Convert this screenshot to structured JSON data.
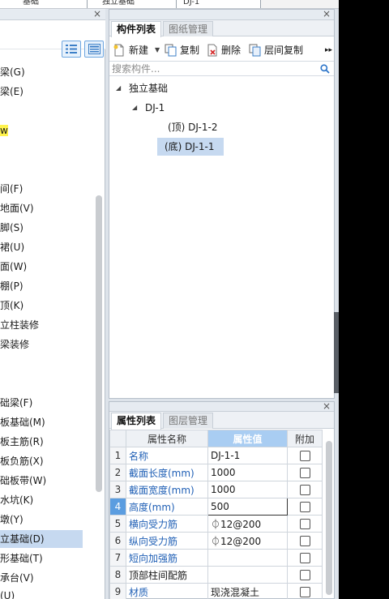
{
  "top_strip": {
    "cells": [
      "基础",
      "独立基础",
      "DJ-1"
    ]
  },
  "left_panel": {
    "items": [
      {
        "label": "梁(G)"
      },
      {
        "label": "梁(E)"
      },
      {
        "label": "w"
      },
      {
        "label": "间(F)"
      },
      {
        "label": "地面(V)"
      },
      {
        "label": "脚(S)"
      },
      {
        "label": "裙(U)"
      },
      {
        "label": "面(W)"
      },
      {
        "label": "棚(P)"
      },
      {
        "label": "顶(K)"
      },
      {
        "label": "立柱装修"
      },
      {
        "label": "梁装修"
      },
      {
        "label": "础梁(F)"
      },
      {
        "label": "板基础(M)"
      },
      {
        "label": "板主筋(R)"
      },
      {
        "label": "板负筋(X)"
      },
      {
        "label": "础板带(W)"
      },
      {
        "label": "水坑(K)"
      },
      {
        "label": "墩(Y)"
      },
      {
        "label": "立基础(D)"
      },
      {
        "label": "形基础(T)"
      },
      {
        "label": "承台(V)"
      },
      {
        "label": "(U)"
      }
    ]
  },
  "components_panel": {
    "tabs": [
      "构件列表",
      "图纸管理"
    ],
    "toolbar": {
      "new_label": "新建",
      "copy_label": "复制",
      "delete_label": "删除",
      "floor_copy_label": "层间复制"
    },
    "search_placeholder": "搜索构件...",
    "tree": {
      "root": "独立基础",
      "child": "DJ-1",
      "leaves": [
        "(顶)  DJ-1-2",
        "(底)  DJ-1-1"
      ]
    }
  },
  "properties_panel": {
    "tabs": [
      "属性列表",
      "图层管理"
    ],
    "headers": [
      "属性名称",
      "属性值",
      "附加"
    ],
    "rows": [
      {
        "num": "1",
        "name": "名称",
        "value": "DJ-1-1"
      },
      {
        "num": "2",
        "name": "截面长度(mm)",
        "value": "1000"
      },
      {
        "num": "3",
        "name": "截面宽度(mm)",
        "value": "1000"
      },
      {
        "num": "4",
        "name": "高度(mm)",
        "value": "500"
      },
      {
        "num": "5",
        "name": "横向受力筋",
        "value": "⏀12@200"
      },
      {
        "num": "6",
        "name": "纵向受力筋",
        "value": "⏀12@200"
      },
      {
        "num": "7",
        "name": "短向加强筋",
        "value": ""
      },
      {
        "num": "8",
        "name": "顶部柱间配筋",
        "value": ""
      },
      {
        "num": "9",
        "name": "材质",
        "value": "现浇混凝土"
      }
    ]
  },
  "colors": {
    "selection": "#c6d9f0",
    "header_active": "#a9cdf2",
    "link_blue": "#1f5fb5",
    "highlight_yellow": "#fff34d"
  }
}
